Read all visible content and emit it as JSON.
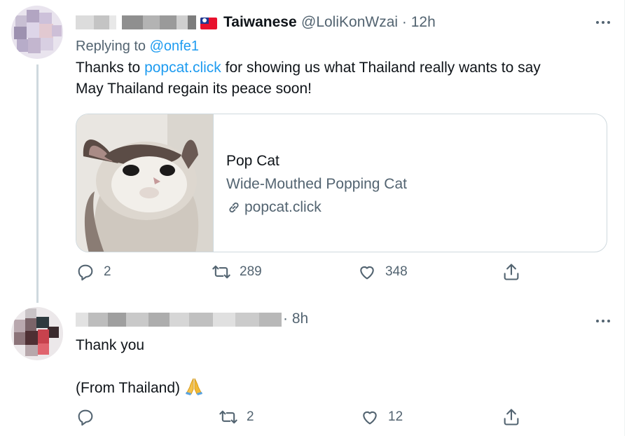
{
  "tweets": [
    {
      "display_name": "Taiwanese",
      "handle": "@LoliKonWzai",
      "time": "· 12h",
      "replying_prefix": "Replying to",
      "replying_to": "@onfe1",
      "text_before_link": "Thanks to ",
      "link": "popcat.click",
      "text_after_link": " for showing us what Thailand really wants to say",
      "text_line2": "May Thailand regain its peace soon!",
      "card": {
        "title": "Pop Cat",
        "description": "Wide-Mouthed Popping Cat",
        "domain": "popcat.click"
      },
      "stats": {
        "replies": "2",
        "retweets": "289",
        "likes": "348"
      }
    },
    {
      "time": "· 8h",
      "text_line1": "Thank you",
      "text_line2": "(From Thailand)",
      "emoji": "folded-hands-icon",
      "stats": {
        "replies": "",
        "retweets": "2",
        "likes": "12"
      }
    }
  ],
  "colors": {
    "accent": "#1d9bf0",
    "secondary_text": "#536471",
    "border": "#cfd9de"
  }
}
